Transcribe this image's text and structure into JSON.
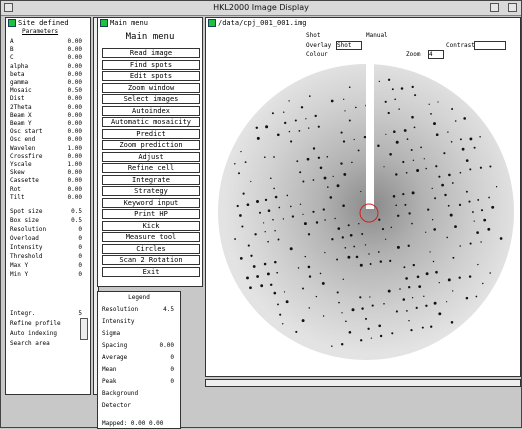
{
  "window": {
    "title": "HKL2000 Image Display"
  },
  "left_panel": {
    "header": "Site defined",
    "subheader": "Parameters",
    "rows": [
      {
        "label": "A",
        "value": "0.00"
      },
      {
        "label": "B",
        "value": "0.00"
      },
      {
        "label": "C",
        "value": "0.00"
      },
      {
        "label": "alpha",
        "value": "0.00"
      },
      {
        "label": "beta",
        "value": "0.00"
      },
      {
        "label": "gamma",
        "value": "0.00"
      },
      {
        "label": "Mosaic",
        "value": "0.50"
      },
      {
        "label": "Dist",
        "value": "0.00"
      },
      {
        "label": "2Theta",
        "value": "0.00"
      },
      {
        "label": "Beam X",
        "value": "0.00"
      },
      {
        "label": "Beam Y",
        "value": "0.00"
      },
      {
        "label": "Osc start",
        "value": "0.00"
      },
      {
        "label": "Osc end",
        "value": "0.00"
      },
      {
        "label": "Wavelen",
        "value": "1.00"
      },
      {
        "label": "Crossfire",
        "value": "0.00"
      },
      {
        "label": "Yscale",
        "value": "1.00"
      },
      {
        "label": "Skew",
        "value": "0.00"
      },
      {
        "label": "Cassette",
        "value": "0.00"
      },
      {
        "label": "Rot",
        "value": "0.00"
      },
      {
        "label": "Tilt",
        "value": "0.00"
      }
    ],
    "fields": [
      {
        "label": "Spot size",
        "value": "0.5"
      },
      {
        "label": "Box size",
        "value": "0.5"
      },
      {
        "label": "Resolution",
        "value": "0"
      },
      {
        "label": "Overload",
        "value": "0"
      },
      {
        "label": "Intensity",
        "value": "0"
      },
      {
        "label": "Threshold",
        "value": "0"
      },
      {
        "label": "Max Y",
        "value": "0"
      },
      {
        "label": "Min Y",
        "value": "0"
      }
    ],
    "bottom_rows": [
      {
        "label": "Integr.",
        "value": "5"
      },
      {
        "label": "Refine profile",
        "value": ""
      },
      {
        "label": "Auto indexing",
        "value": ""
      },
      {
        "label": "Search area",
        "value": ""
      }
    ]
  },
  "menu": {
    "header": "Main menu",
    "buttons": [
      "Read image",
      "Find spots",
      "Edit spots",
      "Zoom window",
      "Select images",
      "Autoindex",
      "Automatic mosaicity",
      "Predict",
      "Zoom prediction",
      "Adjust",
      "Refine cell",
      "Integrate",
      "Strategy",
      "Keyword input",
      "Print HP",
      "Kick",
      "Measure tool",
      "Circles",
      "Scan 2 Rotation",
      "Exit"
    ]
  },
  "stats_panel": {
    "header": "Legend",
    "rows": [
      {
        "label": "Resolution",
        "value": "4.5"
      },
      {
        "label": "Intensity",
        "value": ""
      },
      {
        "label": "Sigma",
        "value": ""
      },
      {
        "label": "Spacing",
        "value": "0.00"
      },
      {
        "label": "Average",
        "value": "0"
      },
      {
        "label": "Mean",
        "value": "0"
      },
      {
        "label": "Peak",
        "value": "0"
      },
      {
        "label": "Background",
        "value": ""
      },
      {
        "label": "Detector",
        "value": ""
      }
    ],
    "footer": "Mapped: 0.00 0.00"
  },
  "image_panel": {
    "filename": "/data/cpj_001_001.img",
    "labels": [
      "Shot",
      "Manual",
      "Overlay",
      "Colour",
      "Contrast",
      "Zoom"
    ],
    "overlay_value": "Shot",
    "contrast_value": "",
    "zoom_value": "4"
  },
  "colors": {
    "accent": "#22c040",
    "beam_marker": "#d02020"
  }
}
